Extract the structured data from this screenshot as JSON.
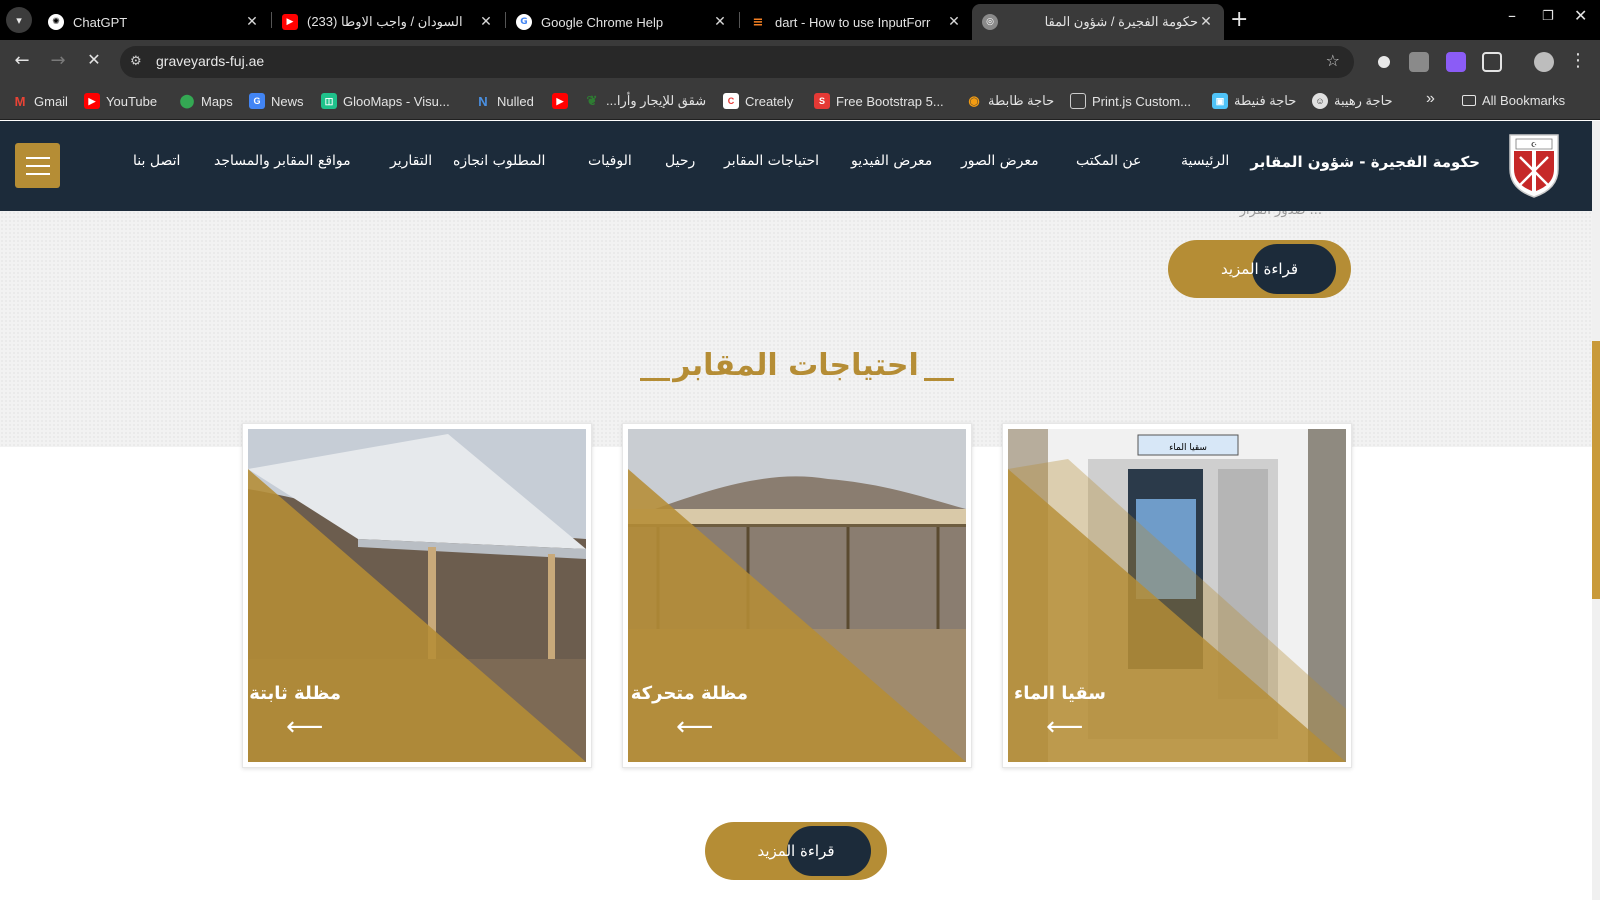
{
  "browser": {
    "tabs": [
      {
        "title": "ChatGPT",
        "icon": "chatgpt-icon",
        "active": false
      },
      {
        "title": "(233) السودان / واجب الاوطا",
        "icon": "youtube-icon",
        "active": false
      },
      {
        "title": "Google Chrome Help",
        "icon": "google-icon",
        "active": false
      },
      {
        "title": "dart - How to use InputForr",
        "icon": "stackoverflow-icon",
        "active": false
      },
      {
        "title": "حكومة الفجيرة / شؤون المقا",
        "icon": "site-icon",
        "active": true
      }
    ],
    "url": "graveyards-fuj.ae",
    "bookmarks": [
      {
        "label": "Gmail",
        "icon": "gmail-icon"
      },
      {
        "label": "YouTube",
        "icon": "youtube-icon"
      },
      {
        "label": "Maps",
        "icon": "maps-icon"
      },
      {
        "label": "News",
        "icon": "news-icon"
      },
      {
        "label": "GlooMaps - Visu...",
        "icon": "gloomaps-icon"
      },
      {
        "label": "Nulled",
        "icon": "nulled-icon"
      },
      {
        "label": "",
        "icon": "youtube-icon"
      },
      {
        "label": "شقق للإيجار وأرا...",
        "icon": "leaf-icon"
      },
      {
        "label": "Creately",
        "icon": "creately-icon"
      },
      {
        "label": "Free Bootstrap 5...",
        "icon": "bootstrap-icon"
      },
      {
        "label": "حاجة ظابطة",
        "icon": "ball-icon"
      },
      {
        "label": "Print.js Custom...",
        "icon": "page-icon"
      },
      {
        "label": "حاجة فنيطة",
        "icon": "picture-icon"
      },
      {
        "label": "حاجة رهيبة",
        "icon": "face-icon"
      }
    ],
    "all_bookmarks": "All Bookmarks",
    "more_bookmarks": "»"
  },
  "site": {
    "title": "حكومة الفجيرة - شؤون المقابر",
    "menu": [
      "الرئيسية",
      "عن المكتب",
      "معرض الصور",
      "معرض الفيديو",
      "احتياجات المقابر",
      "رحيل",
      "الوفيات",
      "المطلوب انجازه",
      "التقارير",
      "مواقع المقابر والمساجد",
      "اتصل بنا"
    ],
    "cut_text": "... صدور القرار",
    "read_more_top": "قراءة المزيد",
    "section_title": "احتياجات المقابر",
    "cards": [
      {
        "label": "سقيا الماء",
        "sign": "سقيا الماء",
        "arrow": "⟵"
      },
      {
        "label": "مظلة متحركة",
        "arrow": "⟵"
      },
      {
        "label": "مظلة ثابتة",
        "arrow": "⟵"
      }
    ],
    "read_more_bottom": "قراءة المزيد"
  },
  "colors": {
    "gold": "#b58d35",
    "navy": "#1c2b3a"
  }
}
